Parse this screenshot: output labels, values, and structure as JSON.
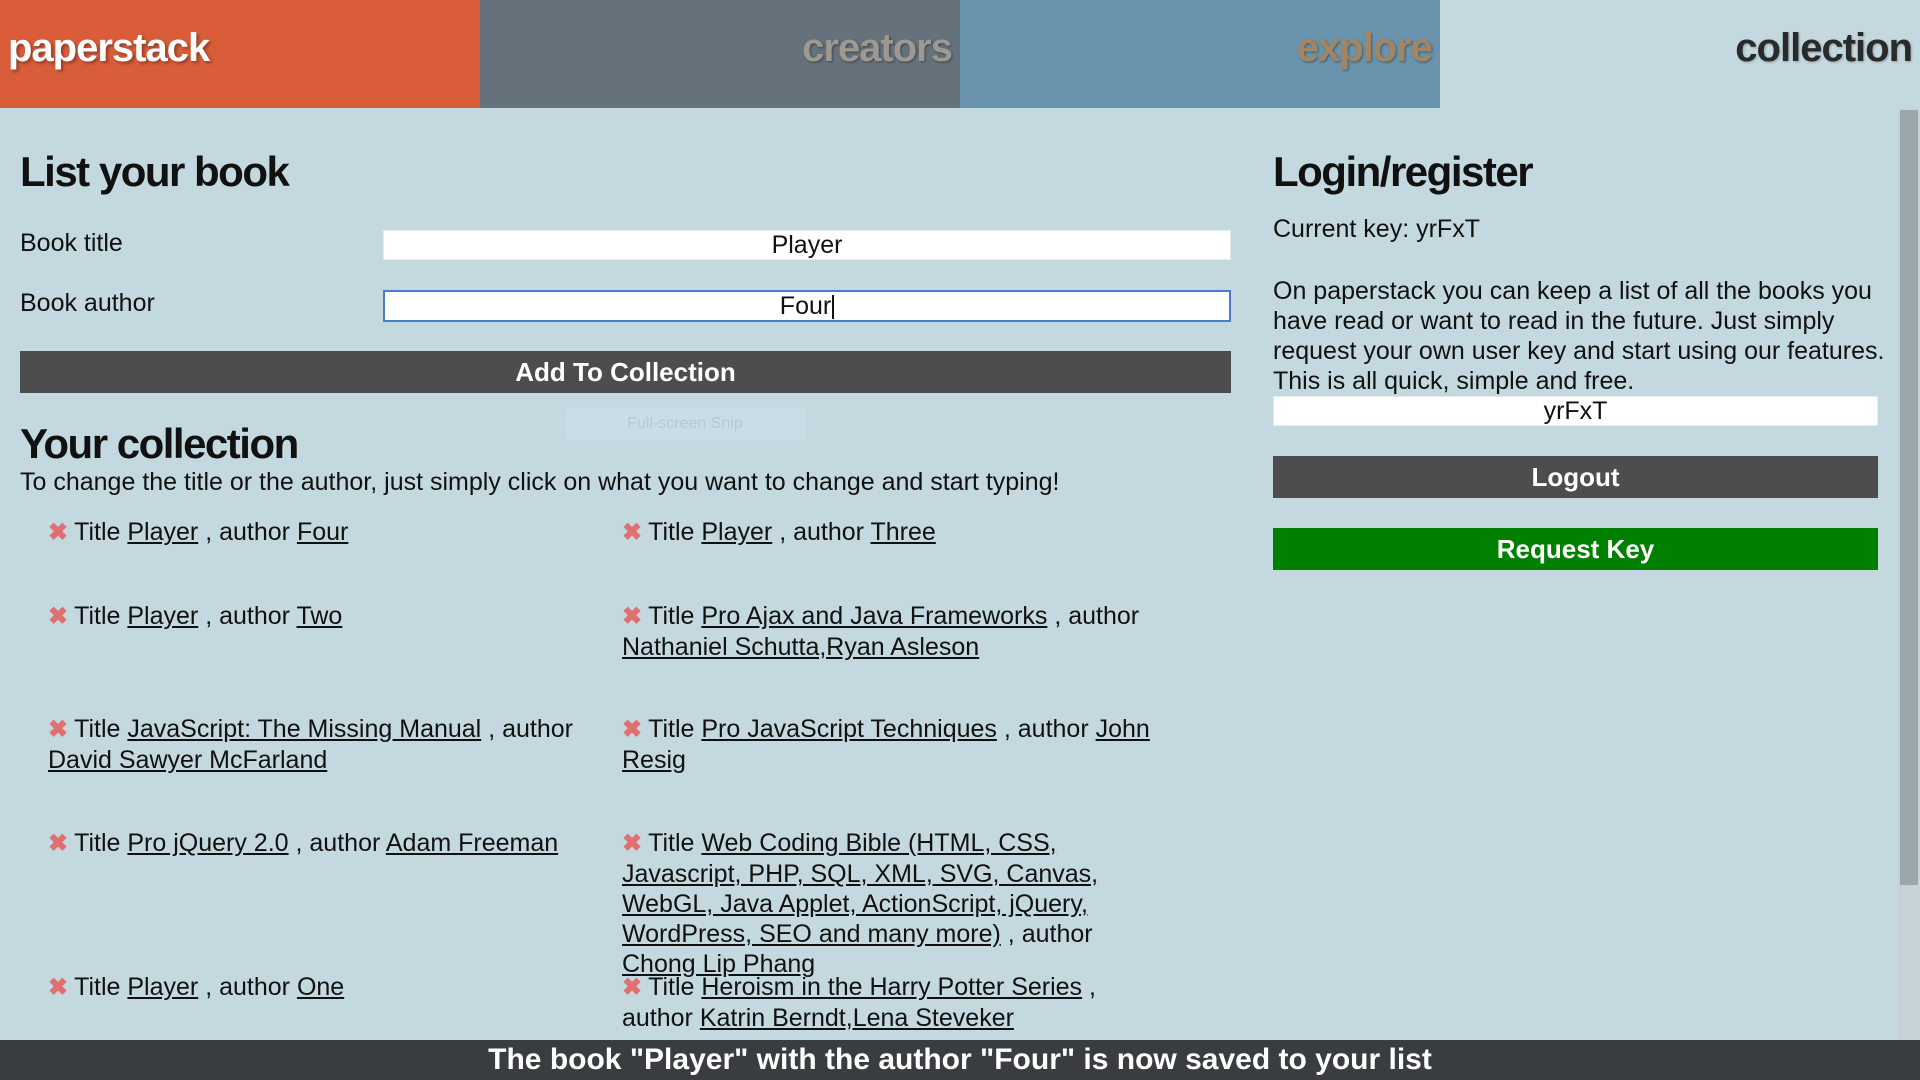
{
  "nav": {
    "brand": "paperstack",
    "creators": "creators",
    "explore": "explore",
    "collection": "collection"
  },
  "list_form": {
    "heading": "List your book",
    "title_label": "Book title",
    "title_value": "Player",
    "author_label": "Book author",
    "author_value": "Four",
    "add_button": "Add To Collection"
  },
  "overlay_text": "Full-screen Snip",
  "collection": {
    "heading": "Your collection",
    "intro": "To change the title or the author, just simply click on what you want to change and start typing!",
    "title_word": "Title",
    "author_word": ", author",
    "books": [
      {
        "title": "Player",
        "author": "Four"
      },
      {
        "title": "Player",
        "author": "Three"
      },
      {
        "title": "Player",
        "author": "Two"
      },
      {
        "title": "Pro Ajax and Java Frameworks",
        "author": "Nathaniel Schutta,Ryan Asleson"
      },
      {
        "title": "JavaScript: The Missing Manual",
        "author": "David Sawyer McFarland"
      },
      {
        "title": "Pro JavaScript Techniques",
        "author": "John Resig"
      },
      {
        "title": "Pro jQuery 2.0",
        "author": "Adam Freeman"
      },
      {
        "title": "Web Coding Bible (HTML, CSS, Javascript, PHP, SQL, XML, SVG, Canvas, WebGL, Java Applet, ActionScript, jQuery, WordPress, SEO and many more)",
        "author": "Chong Lip Phang"
      },
      {
        "title": "Player",
        "author": "One"
      },
      {
        "title": "Heroism in the Harry Potter Series",
        "author": "Katrin Berndt,Lena Steveker"
      }
    ]
  },
  "login": {
    "heading": "Login/register",
    "current_key": "Current key: yrFxT",
    "description": "On paperstack you can keep a list of all the books you have read or want to read in the future. Just simply request your own user key and start using our features. This is all quick, simple and free.",
    "key_value": "yrFxT",
    "logout_button": "Logout",
    "request_button": "Request Key"
  },
  "toast": "The book \"Player\" with the author \"Four\" is now saved to your list",
  "icons": {
    "remove": "remove-x-icon"
  }
}
